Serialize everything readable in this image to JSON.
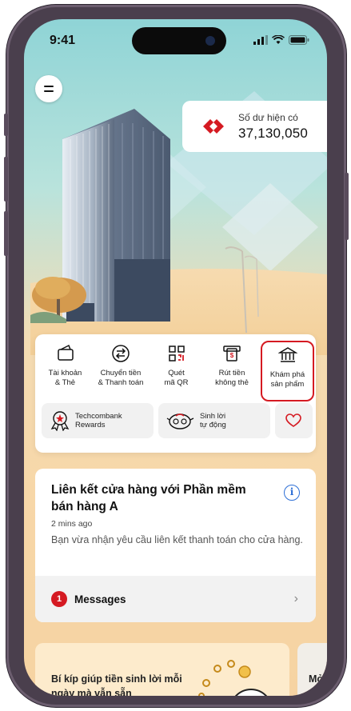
{
  "status_bar": {
    "time": "9:41"
  },
  "balance": {
    "label": "Số dư hiện có",
    "value": "37,130,050"
  },
  "quick_actions": [
    {
      "label": "Tài khoản\n& Thẻ",
      "icon": "wallet-icon"
    },
    {
      "label": "Chuyển tiền\n& Thanh toán",
      "icon": "transfer-icon"
    },
    {
      "label": "Quét\nmã QR",
      "icon": "qr-icon"
    },
    {
      "label": "Rút tiền\nkhông thẻ",
      "icon": "cash-icon"
    },
    {
      "label": "Khám phá\nsản phẩm",
      "icon": "bank-icon",
      "highlighted": true
    }
  ],
  "chips": [
    {
      "label": "Techcombank\nRewards",
      "icon": "rewards-icon"
    },
    {
      "label": "Sinh lời\ntự động",
      "icon": "piggy-icon"
    },
    {
      "label": "",
      "icon": "heart-icon"
    }
  ],
  "message": {
    "title": "Liên kết cửa hàng với Phần mềm bán hàng A",
    "time": "2 mins ago",
    "body": "Bạn vừa nhận yêu cầu liên kết thanh toán cho cửa hàng.",
    "footer_count": "1",
    "footer_label": "Messages"
  },
  "promo": {
    "text": "Bí kíp giúp tiền sinh lời mỗi ngày mà vẫn sẵn",
    "second_text": "Mở\nsẵ"
  },
  "colors": {
    "brand_red": "#d51a22",
    "info_blue": "#2d6fd6"
  }
}
